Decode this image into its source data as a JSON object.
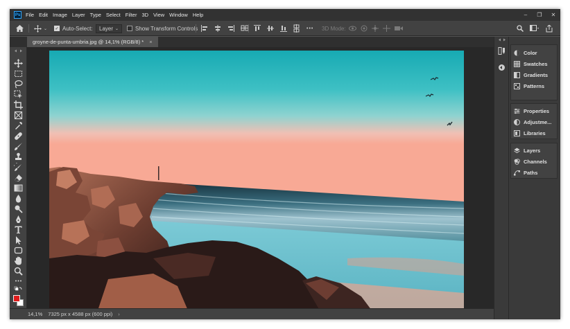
{
  "app": {
    "logo": "Ps"
  },
  "menu": [
    "File",
    "Edit",
    "Image",
    "Layer",
    "Type",
    "Select",
    "Filter",
    "3D",
    "View",
    "Window",
    "Help"
  ],
  "window_controls": {
    "minimize": "–",
    "restore": "❐",
    "close": "✕"
  },
  "options": {
    "auto_select_label": "Auto-Select:",
    "auto_select_checked": true,
    "layer_dropdown": "Layer",
    "transform_label": "Show Transform Controls",
    "transform_checked": false,
    "more": "•••",
    "mode_3d": "3D Mode:"
  },
  "document_tab": {
    "title": "groyne-de-punta-umbria.jpg @ 14,1% (RGB/8) *",
    "close": "×"
  },
  "status": {
    "zoom": "14,1%",
    "info": "7325 px x 4588 px (600 ppi)",
    "arrow": "›"
  },
  "tools": [
    "move-tool",
    "marquee-tool",
    "lasso-tool",
    "object-select-tool",
    "crop-tool",
    "frame-tool",
    "eyedropper-tool",
    "healing-tool",
    "brush-tool",
    "clone-stamp-tool",
    "history-brush-tool",
    "eraser-tool",
    "gradient-tool",
    "blur-tool",
    "dodge-tool",
    "pen-tool",
    "type-tool",
    "path-select-tool",
    "shape-tool",
    "hand-tool",
    "zoom-tool",
    "more-tools"
  ],
  "colors": {
    "foreground": "#e01b1b",
    "background": "#ffffff",
    "accent": "#31a8ff"
  },
  "panels": {
    "group1": [
      "Color",
      "Swatches",
      "Gradients",
      "Patterns"
    ],
    "group2": [
      "Properties",
      "Adjustme...",
      "Libraries"
    ],
    "group3": [
      "Layers",
      "Channels",
      "Paths"
    ]
  }
}
